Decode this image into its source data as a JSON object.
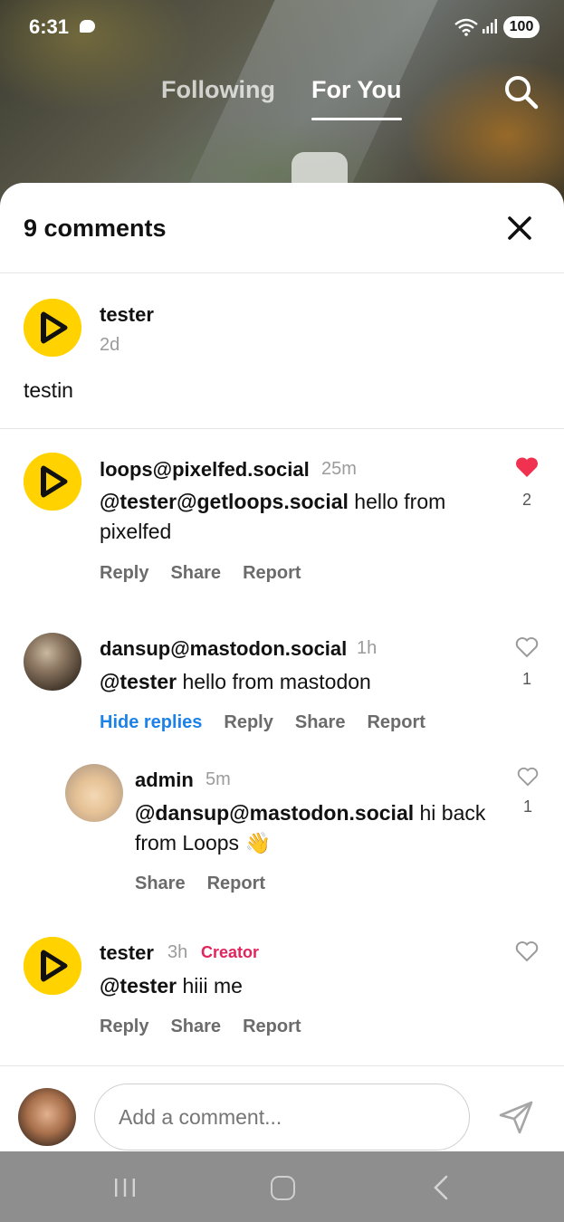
{
  "status": {
    "time": "6:31",
    "battery": "100"
  },
  "tabs": {
    "following": "Following",
    "for_you": "For You"
  },
  "sheet": {
    "title": "9 comments"
  },
  "post": {
    "username": "tester",
    "time": "2d",
    "text": "testin"
  },
  "comments": [
    {
      "username": "loops@pixelfed.social",
      "time": "25m",
      "mention": "@tester@getloops.social",
      "text_line1": " hello from",
      "text_line2": "pixelfed",
      "actions": [
        "Reply",
        "Share",
        "Report"
      ],
      "liked": true,
      "likes": "2"
    },
    {
      "username": "dansup@mastodon.social",
      "time": "1h",
      "mention": "@tester",
      "text": " hello from mastodon",
      "actions": [
        "Hide replies",
        "Reply",
        "Share",
        "Report"
      ],
      "liked": false,
      "likes": "1"
    },
    {
      "username": "admin",
      "time": "5m",
      "mention": "@dansup@mastodon.social",
      "text_line1": " hi back",
      "text_line2": "from Loops 👋",
      "actions": [
        "Share",
        "Report"
      ],
      "liked": false,
      "likes": "1"
    },
    {
      "username": "tester",
      "time": "3h",
      "badge": "Creator",
      "mention": "@tester",
      "text": " hiii me",
      "actions": [
        "Reply",
        "Share",
        "Report"
      ],
      "liked": false
    }
  ],
  "composer": {
    "placeholder": "Add a comment..."
  },
  "icons": {
    "search": "search-icon",
    "close": "close-icon",
    "like": "heart-icon",
    "send": "send-icon"
  },
  "colors": {
    "like_active": "#f0314f",
    "hide_replies": "#1d82e8",
    "creator_badge": "#e0245e",
    "loops_yellow": "#ffd200"
  }
}
